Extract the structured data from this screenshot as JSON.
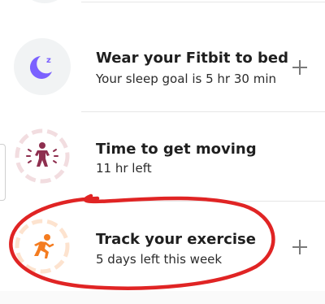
{
  "items": [
    {
      "title": "Wear your Fitbit to bed",
      "subtitle": "Your sleep goal is 5 hr 30 min",
      "icon": "moon-icon",
      "icon_color": "#7b61ff",
      "has_plus": true,
      "plus_label": "+"
    },
    {
      "title": "Time to get moving",
      "subtitle": "11 hr left",
      "icon": "person-moving-icon",
      "icon_color": "#8e2f4f",
      "has_plus": false
    },
    {
      "title": "Track your exercise",
      "subtitle": "5 days left this week",
      "icon": "running-icon",
      "icon_color": "#f47c20",
      "has_plus": true,
      "plus_label": "+"
    }
  ],
  "annotation": {
    "shape": "freehand-ellipse",
    "color": "#e02424",
    "target": "Track your exercise"
  }
}
